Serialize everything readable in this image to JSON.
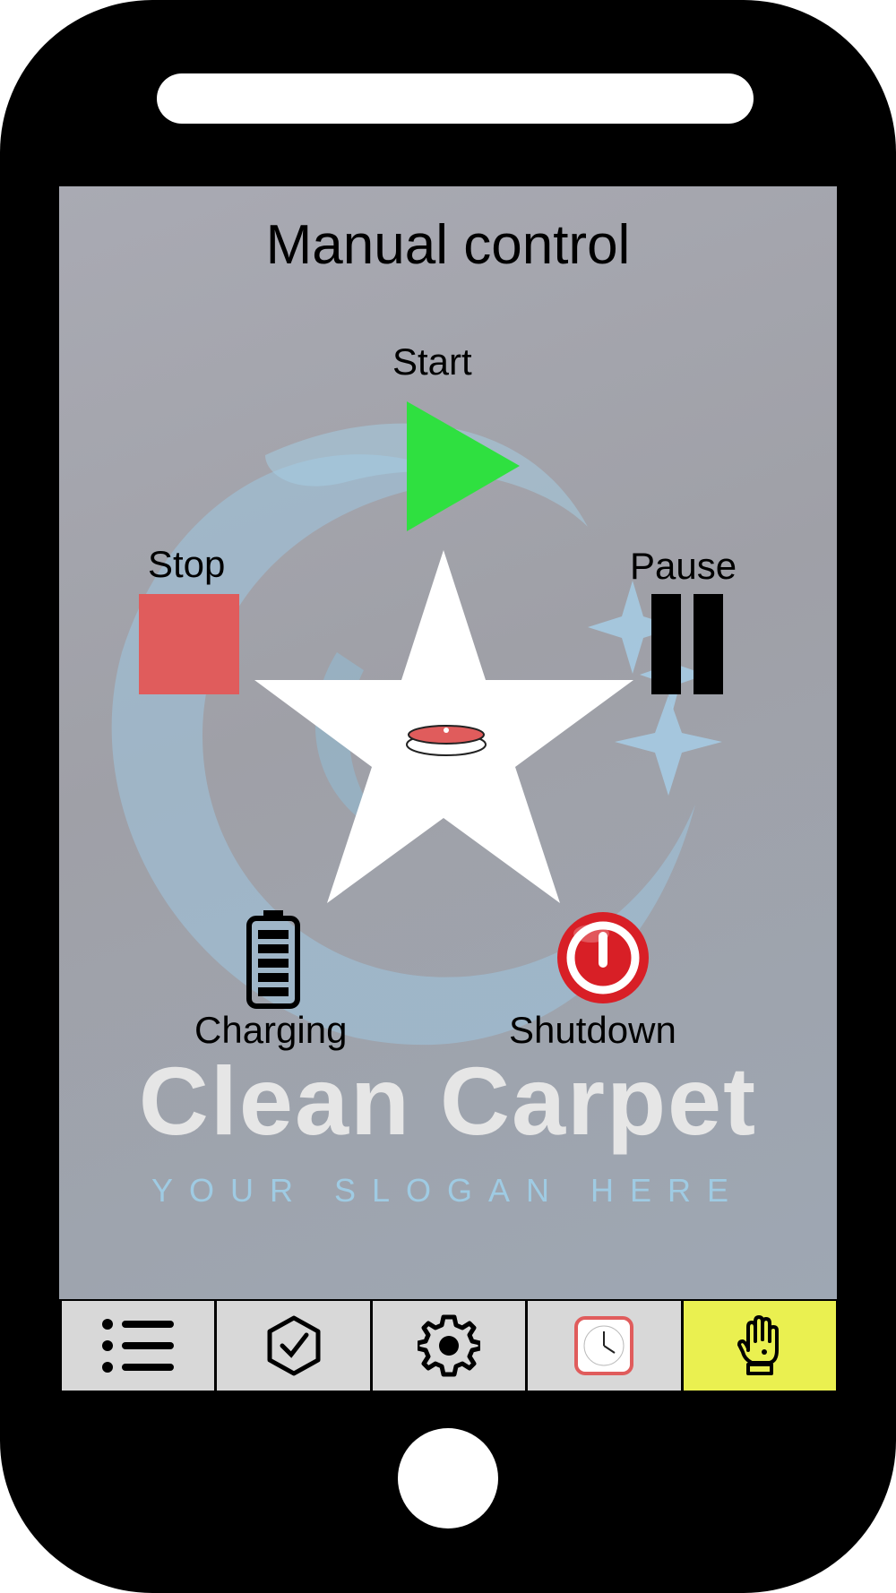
{
  "screen": {
    "title": "Manual control"
  },
  "controls": {
    "start_label": "Start",
    "stop_label": "Stop",
    "pause_label": "Pause",
    "charging_label": "Charging",
    "shutdown_label": "Shutdown"
  },
  "brand": {
    "name": "Clean Carpet",
    "slogan": "YOUR SLOGAN HERE"
  },
  "colors": {
    "start": "#2fe040",
    "stop": "#e05c5c",
    "shutdown": "#d81f26",
    "active_tab": "#eaf050",
    "tab_bg": "#d8d8d8"
  },
  "navbar": {
    "tabs": [
      {
        "icon": "list-icon",
        "active": false
      },
      {
        "icon": "shield-check-icon",
        "active": false
      },
      {
        "icon": "gear-icon",
        "active": false
      },
      {
        "icon": "clock-icon",
        "active": false
      },
      {
        "icon": "hand-icon",
        "active": true
      }
    ]
  }
}
